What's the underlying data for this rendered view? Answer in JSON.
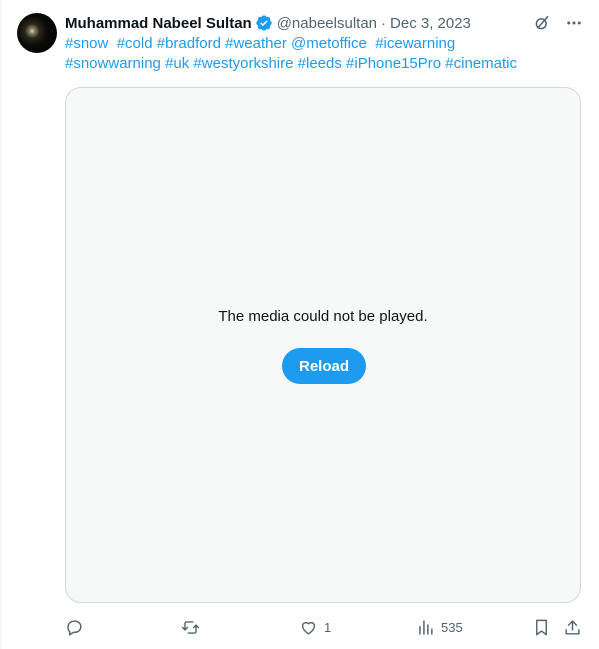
{
  "tweet": {
    "author_name": "Muhammad Nabeel Sultan",
    "handle": "@nabeelsultan",
    "separator": "·",
    "date": "Dec 3, 2023",
    "hashtags": [
      "#snow",
      "#cold",
      "#bradford",
      "#weather",
      "@metoffice",
      "#icewarning",
      "#snowwarning",
      "#uk",
      "#westyorkshire",
      "#leeds",
      "#iPhone15Pro",
      "#cinematic"
    ]
  },
  "media": {
    "message": "The media could not be played.",
    "reload_label": "Reload"
  },
  "actions": {
    "reply_count": "",
    "retweet_count": "",
    "like_count": "1",
    "views_count": "535"
  },
  "colors": {
    "accent": "#1d9bf0",
    "text_secondary": "#536471",
    "media_bg": "#f7f9f9"
  },
  "icons": [
    "verified-badge-icon",
    "grok-icon",
    "more-icon",
    "reply-icon",
    "retweet-icon",
    "like-icon",
    "views-icon",
    "bookmark-icon",
    "share-icon"
  ]
}
